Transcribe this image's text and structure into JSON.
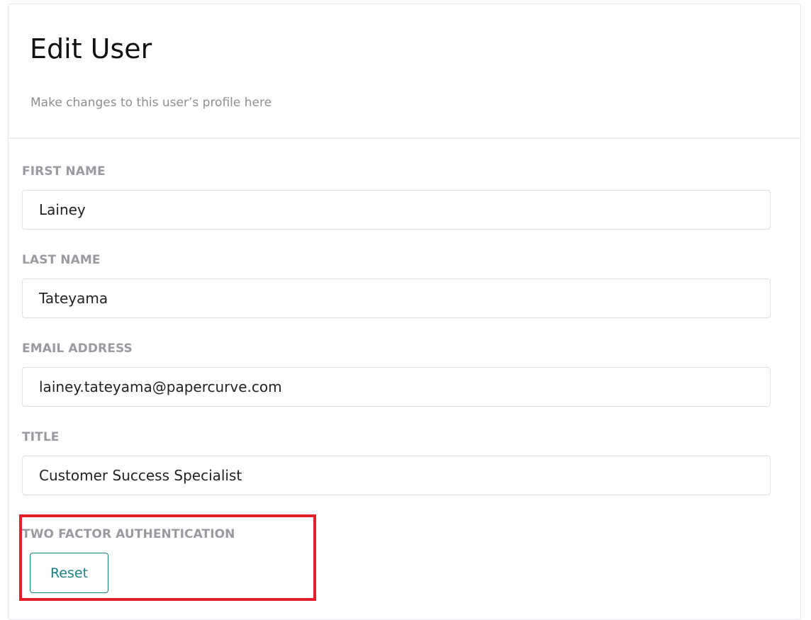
{
  "header": {
    "title": "Edit User",
    "subtitle": "Make changes to this user’s profile here"
  },
  "form": {
    "first_name": {
      "label": "FIRST NAME",
      "value": "Lainey"
    },
    "last_name": {
      "label": "LAST NAME",
      "value": "Tateyama"
    },
    "email": {
      "label": "EMAIL ADDRESS",
      "value": "lainey.tateyama@papercurve.com"
    },
    "title": {
      "label": "TITLE",
      "value": "Customer Success Specialist"
    },
    "two_factor": {
      "label": "TWO FACTOR AUTHENTICATION",
      "button_label": "Reset"
    }
  },
  "colors": {
    "accent": "#1a7f85",
    "highlight": "#e0212b",
    "label": "#9a9aa0"
  }
}
